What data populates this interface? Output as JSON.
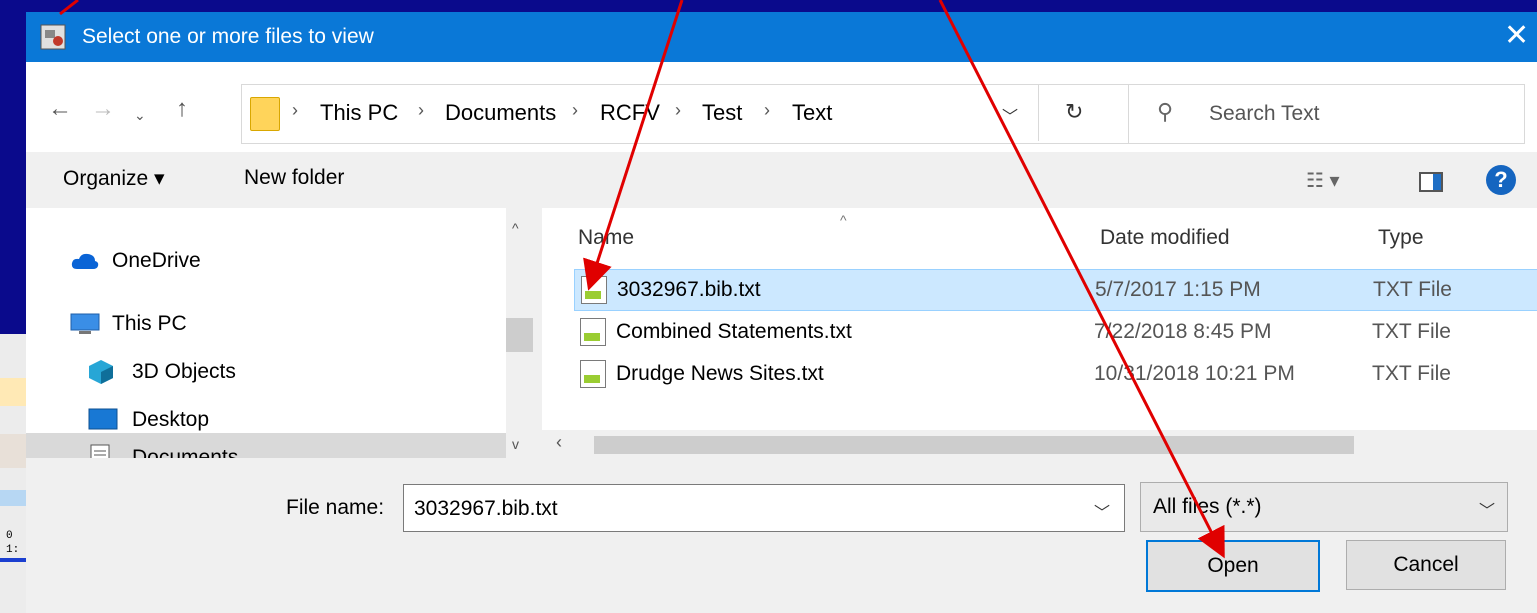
{
  "dialog": {
    "title": "Select one or more files to view",
    "close_glyph": "✕"
  },
  "address": {
    "breadcrumbs": [
      "This PC",
      "Documents",
      "RCFV",
      "Test",
      "Text"
    ],
    "separator": "›",
    "search_placeholder": "Search Text"
  },
  "toolbar": {
    "organize": "Organize ▾",
    "new_folder": "New folder"
  },
  "nav": {
    "items": [
      {
        "label": "OneDrive",
        "icon": "cloud-icon"
      },
      {
        "label": "This PC",
        "icon": "computer-icon"
      },
      {
        "label": "3D Objects",
        "icon": "cube-icon"
      },
      {
        "label": "Desktop",
        "icon": "desktop-icon"
      },
      {
        "label": "Documents",
        "icon": "document-icon"
      }
    ]
  },
  "filelist": {
    "columns": [
      "Name",
      "Date modified",
      "Type"
    ],
    "rows": [
      {
        "name": "3032967.bib.txt",
        "date": "5/7/2017 1:15 PM",
        "type": "TXT File",
        "selected": true
      },
      {
        "name": "Combined Statements.txt",
        "date": "7/22/2018 8:45 PM",
        "type": "TXT File",
        "selected": false
      },
      {
        "name": "Drudge News Sites.txt",
        "date": "10/31/2018 10:21 PM",
        "type": "TXT File",
        "selected": false
      }
    ]
  },
  "bottom": {
    "file_name_label": "File name:",
    "file_name_value": "3032967.bib.txt",
    "file_type": "All files (*.*)",
    "open": "Open",
    "cancel": "Cancel"
  },
  "background": {
    "code_lines": [
      "0",
      "1:"
    ]
  },
  "colors": {
    "titlebar": "#0a78d7",
    "selection": "#cce8ff",
    "background": "#0a0a8c",
    "arrow": "#e00000"
  }
}
